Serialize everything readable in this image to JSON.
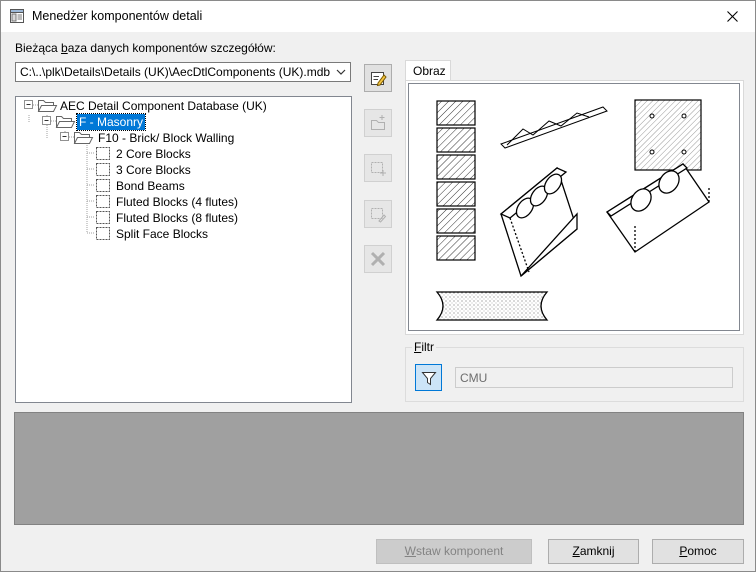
{
  "window": {
    "title": "Menedżer komponentów detali",
    "close_glyph": "✕"
  },
  "database": {
    "label_pre": "Bieżąca ",
    "label_acc": "b",
    "label_post": "aza danych komponentów szczegółów:",
    "path": "C:\\..\\plk\\Details\\Details (UK)\\AecDtlComponents (UK).mdb"
  },
  "tree": {
    "root": "AEC Detail Component Database (UK)",
    "group": "F - Masonry",
    "subgroup": "F10 - Brick/ Block Walling",
    "items": [
      "2 Core Blocks",
      "3 Core Blocks",
      "Bond Beams",
      "Fluted Blocks (4 flutes)",
      "Fluted Blocks (8 flutes)",
      "Split Face Blocks"
    ]
  },
  "toolbar": {
    "icons": [
      "edit-database-icon",
      "new-group-icon",
      "new-component-icon",
      "edit-component-icon",
      "delete-icon"
    ]
  },
  "preview": {
    "tab_label": "Obraz"
  },
  "filter": {
    "legend_acc": "F",
    "legend_rest": "iltr",
    "value": "CMU"
  },
  "buttons": {
    "insert_acc": "W",
    "insert_rest": "staw komponent",
    "close_acc": "Z",
    "close_rest": "amknij",
    "help_acc": "P",
    "help_rest": "omoc"
  }
}
